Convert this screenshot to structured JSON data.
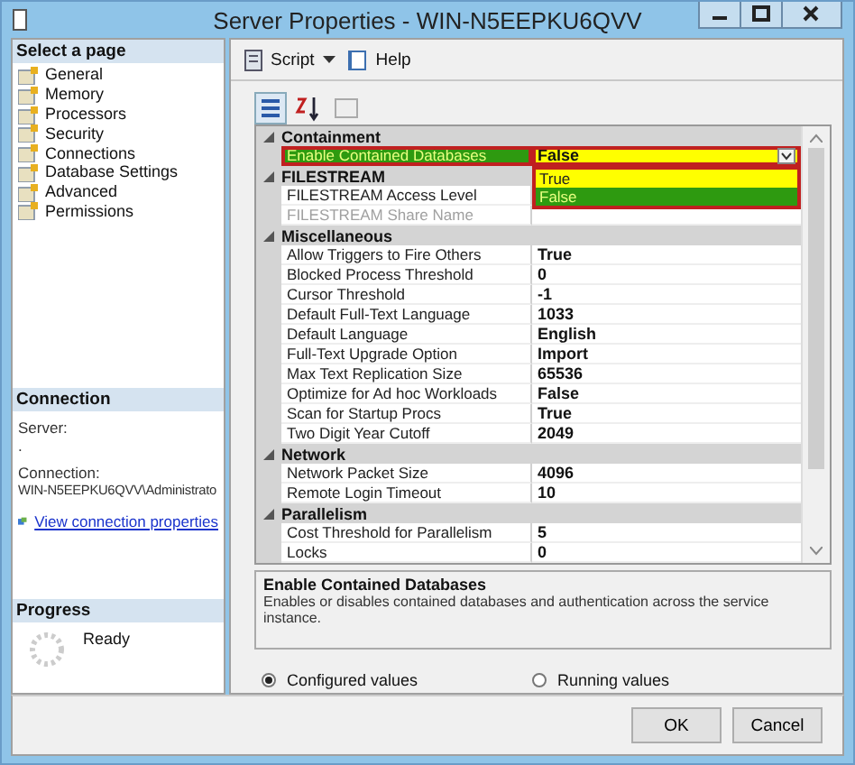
{
  "window": {
    "title": "Server Properties - WIN-N5EEPKU6QVV"
  },
  "sidebar": {
    "header": "Select a page",
    "pages": [
      "General",
      "Memory",
      "Processors",
      "Security",
      "Connections",
      "Database Settings",
      "Advanced",
      "Permissions"
    ]
  },
  "connection": {
    "header": "Connection",
    "server_label": "Server:",
    "server_value": ".",
    "connection_label": "Connection:",
    "connection_value": "WIN-N5EEPKU6QVV\\Administrato",
    "link": "View connection properties"
  },
  "progress": {
    "header": "Progress",
    "status": "Ready"
  },
  "toolbar": [
    "Script",
    "Help"
  ],
  "grid": {
    "groups": [
      {
        "name": "Containment",
        "expanded": true,
        "rows": [
          {
            "name": "Enable Contained Databases",
            "value": "False",
            "selected": true,
            "disabled": false,
            "dropdown": [
              {
                "label": "True",
                "selected": false
              },
              {
                "label": "False",
                "selected": true
              }
            ]
          }
        ]
      },
      {
        "name": "FILESTREAM",
        "expanded": true,
        "rows": [
          {
            "name": "FILESTREAM Access Level",
            "selected": false,
            "disabled": false
          },
          {
            "name": "FILESTREAM Share Name",
            "selected": false,
            "disabled": true
          }
        ]
      },
      {
        "name": "Miscellaneous",
        "expanded": true,
        "rows": [
          {
            "name": "Allow Triggers to Fire Others",
            "value": "True",
            "selected": false,
            "disabled": false
          },
          {
            "name": "Blocked Process Threshold",
            "value": "0",
            "selected": false,
            "disabled": false
          },
          {
            "name": "Cursor Threshold",
            "value": "-1",
            "selected": false,
            "disabled": false
          },
          {
            "name": "Default Full-Text Language",
            "value": "1033",
            "selected": false,
            "disabled": false
          },
          {
            "name": "Default Language",
            "value": "English",
            "selected": false,
            "disabled": false
          },
          {
            "name": "Full-Text Upgrade Option",
            "value": "Import",
            "selected": false,
            "disabled": false
          },
          {
            "name": "Max Text Replication Size",
            "value": "65536",
            "selected": false,
            "disabled": false
          },
          {
            "name": "Optimize for Ad hoc Workloads",
            "value": "False",
            "selected": false,
            "disabled": false
          },
          {
            "name": "Scan for Startup Procs",
            "value": "True",
            "selected": false,
            "disabled": false
          },
          {
            "name": "Two Digit Year Cutoff",
            "value": "2049",
            "selected": false,
            "disabled": false
          }
        ]
      },
      {
        "name": "Network",
        "expanded": true,
        "rows": [
          {
            "name": "Network Packet Size",
            "value": "4096",
            "selected": false,
            "disabled": false
          },
          {
            "name": "Remote Login Timeout",
            "value": "10",
            "selected": false,
            "disabled": false
          }
        ]
      },
      {
        "name": "Parallelism",
        "expanded": true,
        "rows": [
          {
            "name": "Cost Threshold for Parallelism",
            "value": "5",
            "selected": false,
            "disabled": false
          },
          {
            "name": "Locks",
            "value": "0",
            "selected": false,
            "disabled": false
          }
        ]
      }
    ]
  },
  "description": {
    "title": "Enable Contained Databases",
    "text": "Enables or disables contained databases and authentication across the service instance."
  },
  "radios": [
    {
      "label": "Configured values",
      "selected": true
    },
    {
      "label": "Running values",
      "selected": false
    }
  ],
  "buttons": [
    "OK",
    "Cancel"
  ]
}
